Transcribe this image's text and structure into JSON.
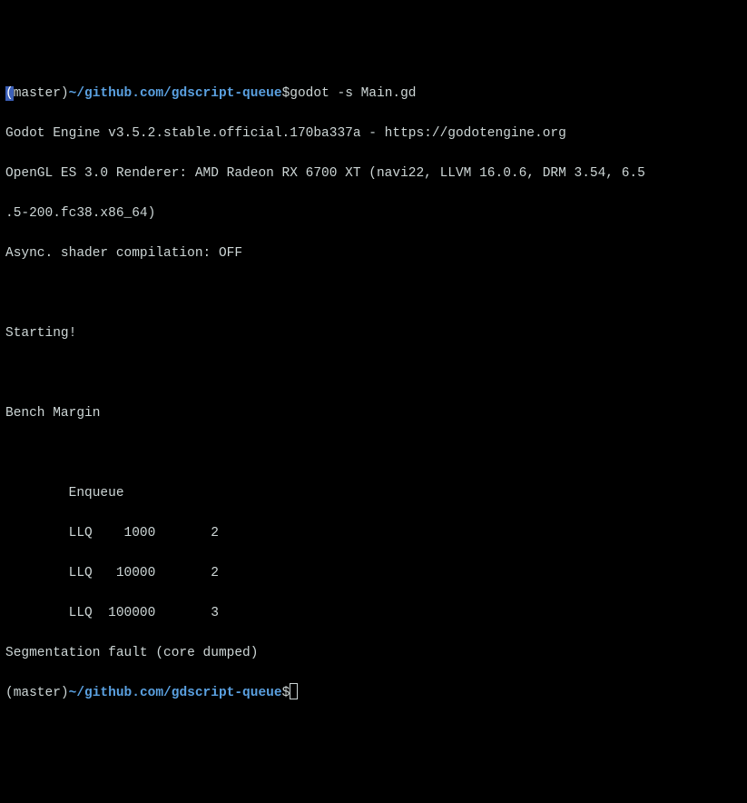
{
  "prompt1": {
    "branch_open": "(",
    "branch_name": "master",
    "branch_close": ")",
    "path": "~/github.com/gdscript-queue",
    "dollar": "$",
    "command": "godot -s Main.gd"
  },
  "output": {
    "l1": "Godot Engine v3.5.2.stable.official.170ba337a - https://godotengine.org",
    "l2": "OpenGL ES 3.0 Renderer: AMD Radeon RX 6700 XT (navi22, LLVM 16.0.6, DRM 3.54, 6.5",
    "l3": ".5-200.fc38.x86_64)",
    "l4": "Async. shader compilation: OFF",
    "l5": " ",
    "l6": "Starting!",
    "l7": " ",
    "l8": "Bench Margin",
    "l9": " ",
    "l10": "        Enqueue",
    "l11": "        LLQ    1000       2",
    "l12": "        LLQ   10000       2",
    "l13": "        LLQ  100000       3",
    "l14": "Segmentation fault (core dumped)"
  },
  "prompt2": {
    "branch_open": "(",
    "branch_name": "master",
    "branch_close": ")",
    "path": "~/github.com/gdscript-queue",
    "dollar": "$"
  }
}
